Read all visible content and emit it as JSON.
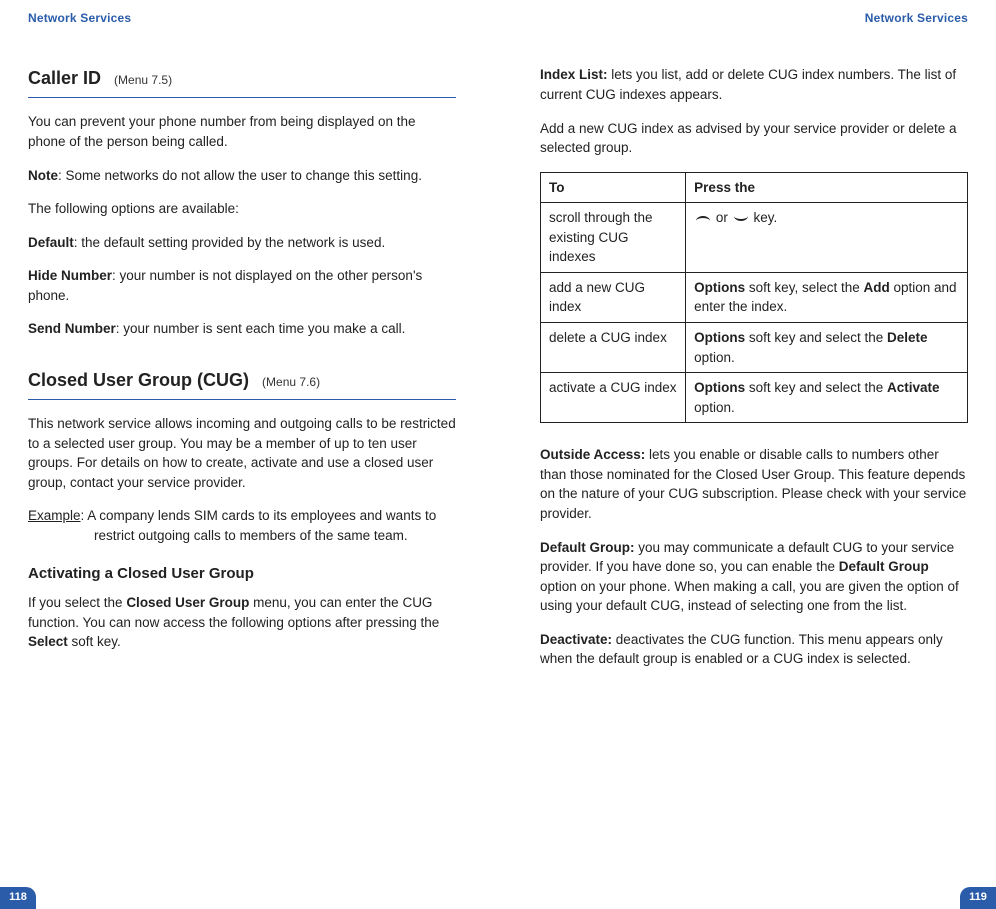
{
  "header": {
    "left": "Network Services",
    "right": "Network Services"
  },
  "pageNumbers": {
    "left": "118",
    "right": "119"
  },
  "left": {
    "callerId": {
      "title": "Caller ID",
      "menu": "(Menu 7.5)",
      "intro": "You can prevent your phone number from being displayed on the phone of the person being called.",
      "noteLabel": "Note",
      "noteText": ": Some networks do not allow the user to change this setting.",
      "optionsLead": "The following options are available:",
      "defaultLabel": "Default",
      "defaultText": ": the default setting provided by the network is used.",
      "hideLabel": "Hide Number",
      "hideText": ": your number is not displayed on the other person's phone.",
      "sendLabel": "Send Number",
      "sendText": ": your number is sent each time you make a call."
    },
    "cug": {
      "title": "Closed User Group (CUG)",
      "menu": "(Menu 7.6)",
      "intro": "This network service allows incoming and outgoing calls to be restricted to a selected user group. You may be a member of up to ten user groups. For details on how to create, activate and use a closed user group, contact your service provider.",
      "exampleLabel": "Example",
      "exampleText": ": A company lends SIM cards to its employees and wants to restrict outgoing calls to members of the same team.",
      "activatingHeading": "Activating a Closed User Group",
      "activating_pre": "If you select the ",
      "activating_b1": "Closed User Group",
      "activating_mid": " menu, you can enter the CUG function. You can now access the following options after pressing the ",
      "activating_b2": "Select",
      "activating_post": " soft key."
    }
  },
  "right": {
    "indexList": {
      "label": "Index List:",
      "text": " lets you list, add or delete CUG index numbers. The list of current CUG indexes appears."
    },
    "addNew": "Add a new CUG index as advised by your service provider or delete a selected group.",
    "table": {
      "th1": "To",
      "th2": "Press the",
      "rows": [
        {
          "to": "scroll through the existing CUG indexes",
          "press_pre": "",
          "press_b": "",
          "press_post": " or ",
          "press_tail": " key.",
          "arrows": true
        },
        {
          "to": "add a new CUG index",
          "press_pre": "",
          "press_b": "Options",
          "press_mid": " soft key, select the ",
          "press_b2": "Add",
          "press_post": " option and enter the index."
        },
        {
          "to": "delete a CUG index",
          "press_pre": "",
          "press_b": "Options",
          "press_mid": " soft key and select the ",
          "press_b2": "Delete",
          "press_post": " option."
        },
        {
          "to": "activate a CUG index",
          "press_pre": "",
          "press_b": "Options",
          "press_mid": " soft key and select the ",
          "press_b2": "Activate",
          "press_post": " option."
        }
      ]
    },
    "outside": {
      "label": "Outside Access:",
      "text": " lets you enable or disable calls to numbers other than those nominated for the Closed User Group. This feature depends on the nature of your CUG subscription. Please check with your service provider."
    },
    "defaultGroup": {
      "label": "Default Group:",
      "text_pre": " you may communicate a default CUG to your service provider. If you have done so, you can enable the ",
      "text_b": "Default Group",
      "text_post": " option on your phone. When making a call, you are given the option of using your default CUG, instead of selecting one from the list."
    },
    "deactivate": {
      "label": "Deactivate:",
      "text": " deactivates the CUG function. This menu appears only when the default group is enabled or a CUG index is selected."
    }
  }
}
